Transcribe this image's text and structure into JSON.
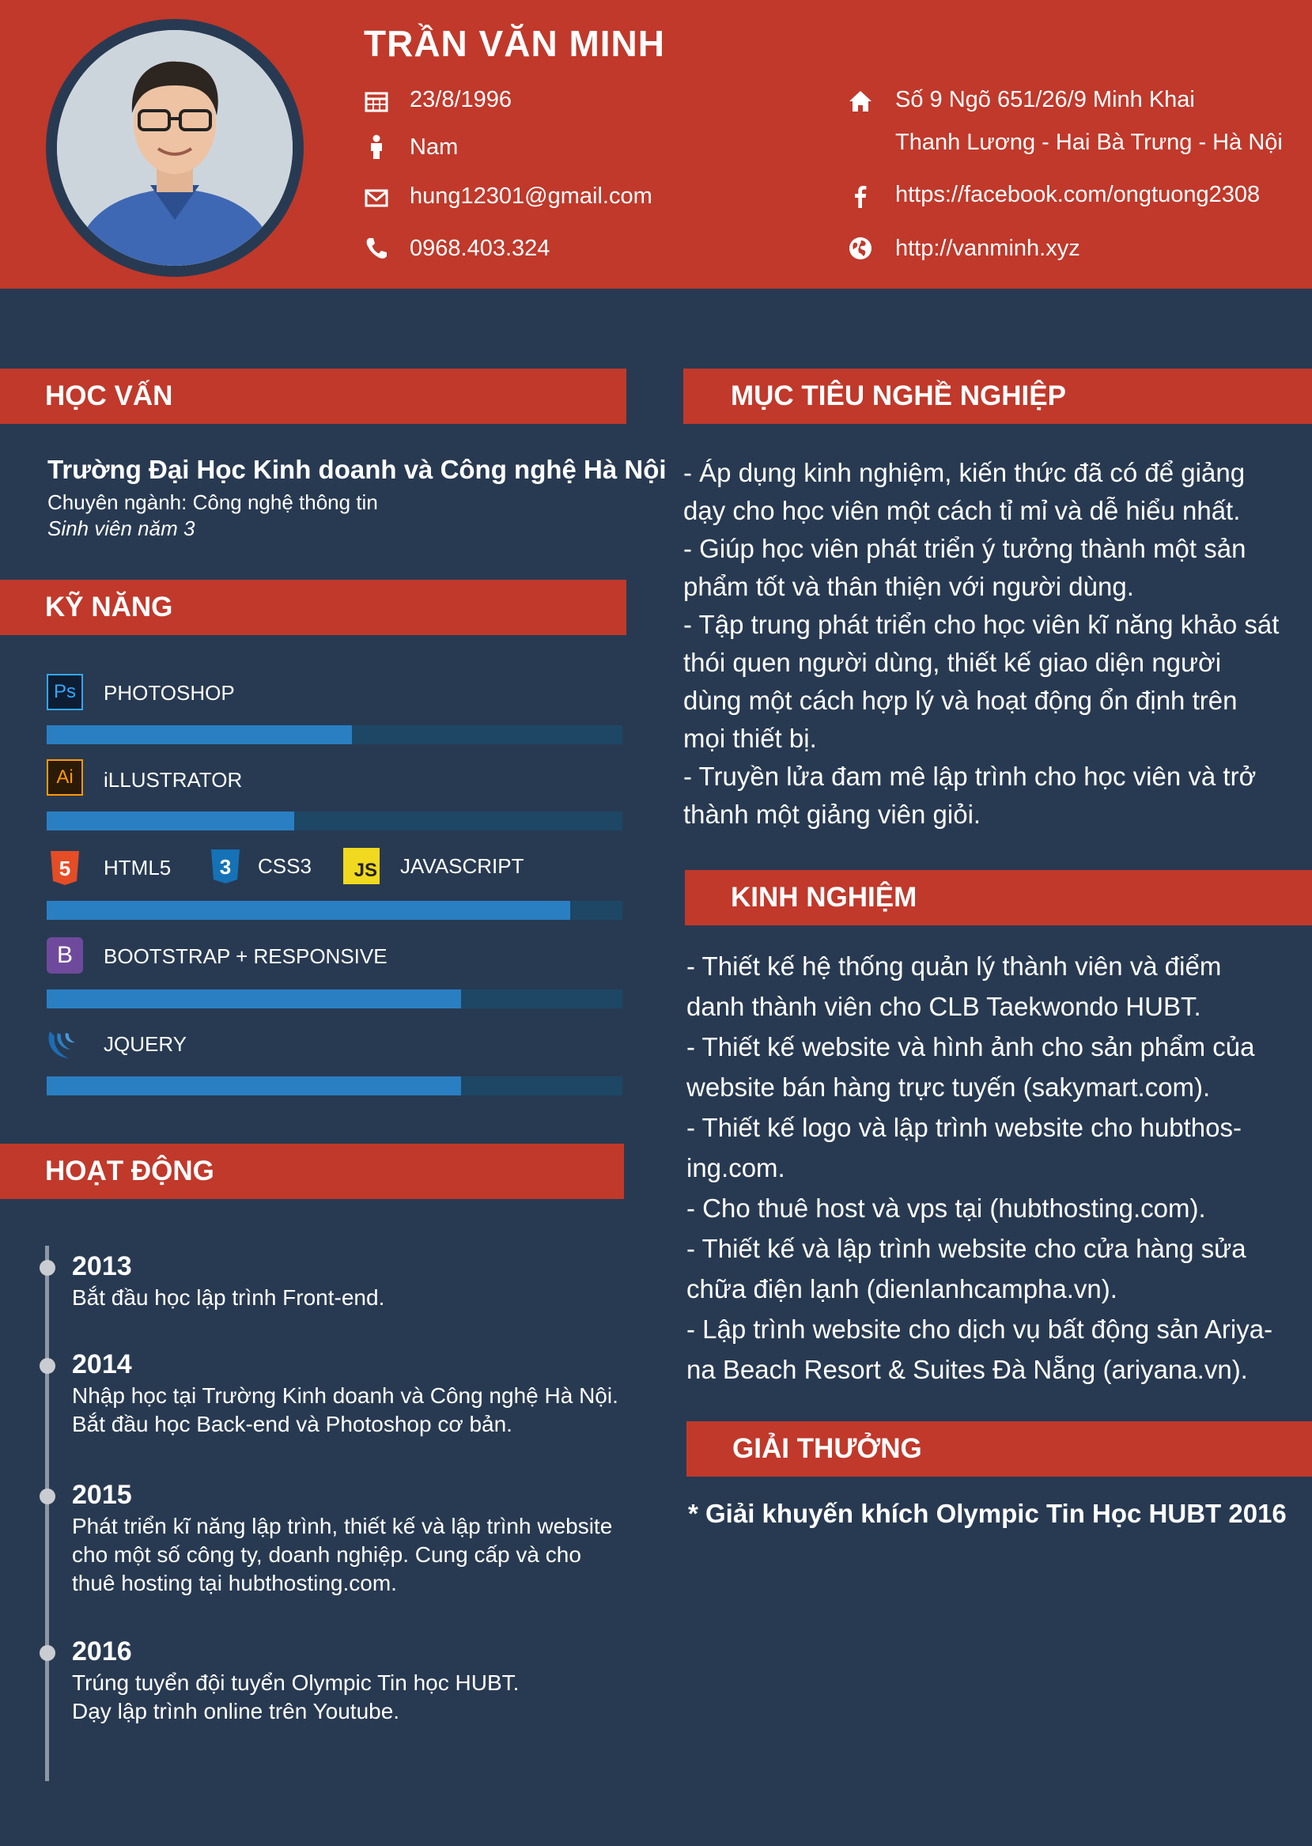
{
  "header": {
    "name": "TRẦN VĂN MINH",
    "birthday": "23/8/1996",
    "gender": "Nam",
    "email": "hung12301@gmail.com",
    "phone": "0968.403.324",
    "address_line1": "Số 9 Ngõ 651/26/9 Minh Khai",
    "address_line2": "Thanh Lương - Hai Bà Trưng - Hà Nội",
    "facebook": "https://facebook.com/ongtuong2308",
    "website": "http://vanminh.xyz",
    "icons": [
      "calendar-icon",
      "person-icon",
      "mail-icon",
      "phone-icon",
      "home-icon",
      "facebook-icon",
      "globe-icon"
    ]
  },
  "education": {
    "title": "HỌC VẤN",
    "school": "Trường Đại Học Kinh doanh và Công nghệ Hà Nội",
    "major": "Chuyên ngành: Công nghệ thông tin",
    "year": "Sinh viên năm 3"
  },
  "skills": {
    "title": "KỸ NĂNG",
    "items": [
      {
        "label": "PHOTOSHOP",
        "icon": "Ps",
        "level": 0.53
      },
      {
        "label": "iLLUSTRATOR",
        "icon": "Ai",
        "level": 0.43
      },
      {
        "label": "HTML5",
        "icon": "5",
        "level": 0.91
      },
      {
        "label": "CSS3",
        "icon": "3",
        "level": 0.91
      },
      {
        "label": "JAVASCRIPT",
        "icon": "JS",
        "level": 0.91
      },
      {
        "label": "BOOTSTRAP + RESPONSIVE",
        "icon": "B",
        "level": 0.72
      },
      {
        "label": "JQUERY",
        "icon": "jquery-icon",
        "level": 0.72
      }
    ]
  },
  "activities": {
    "title": "HOẠT ĐỘNG",
    "items": [
      {
        "year": "2013",
        "lines": [
          "Bắt đầu học lập trình Front-end."
        ]
      },
      {
        "year": "2014",
        "lines": [
          "Nhập học tại Trường Kinh doanh và Công nghệ Hà Nội.",
          "Bắt đầu học Back-end và Photoshop cơ bản."
        ]
      },
      {
        "year": "2015",
        "lines": [
          "Phát triển kĩ năng lập trình, thiết kế và lập trình website",
          "cho một số công ty, doanh nghiệp. Cung cấp và cho",
          "thuê hosting tại hubthosting.com."
        ]
      },
      {
        "year": "2016",
        "lines": [
          "Trúng tuyển đội tuyển Olympic Tin học HUBT.",
          "Dạy lập trình online trên Youtube."
        ]
      }
    ]
  },
  "objective": {
    "title": "MỤC TIÊU NGHỀ NGHIỆP",
    "lines": [
      "- Áp dụng kinh nghiệm, kiến thức đã có để giảng",
      "dạy cho học viên một cách tỉ mỉ và dễ hiểu nhất.",
      "- Giúp học viên phát triển ý tưởng thành một sản",
      "phẩm tốt và thân thiện với người dùng.",
      "- Tập trung phát triển cho học viên kĩ năng khảo sát",
      "thói quen người dùng, thiết kế giao diện người",
      "dùng một cách hợp lý và hoạt động ổn định trên",
      "mọi thiết bị.",
      "- Truyền lửa đam mê lập trình cho học viên và trở",
      "thành một giảng viên giỏi."
    ]
  },
  "experience": {
    "title": "KINH NGHIỆM",
    "lines": [
      "- Thiết kế hệ thống quản lý thành viên và điểm",
      "danh thành viên cho CLB Taekwondo HUBT.",
      "- Thiết kế website và hình ảnh cho sản phẩm của",
      "website bán hàng trực tuyến (sakymart.com).",
      "- Thiết kế logo và lập trình website cho hubthos-",
      "ing.com.",
      "- Cho thuê host và vps tại (hubthosting.com).",
      "- Thiết kế và lập trình website cho cửa hàng sửa",
      "chữa điện lạnh (dienlanhcampha.vn).",
      "- Lập trình website cho dịch vụ bất động sản Ariya-",
      "na Beach Resort & Suites Đà Nẵng (ariyana.vn)."
    ]
  },
  "awards": {
    "title": "GIẢI THƯỞNG",
    "text": "* Giải khuyến khích Olympic Tin Học HUBT 2016"
  },
  "colors": {
    "accent": "#c0392b",
    "background": "#283a52",
    "bar_fill": "#2a7fc2",
    "bar_track": "#1e4766"
  }
}
